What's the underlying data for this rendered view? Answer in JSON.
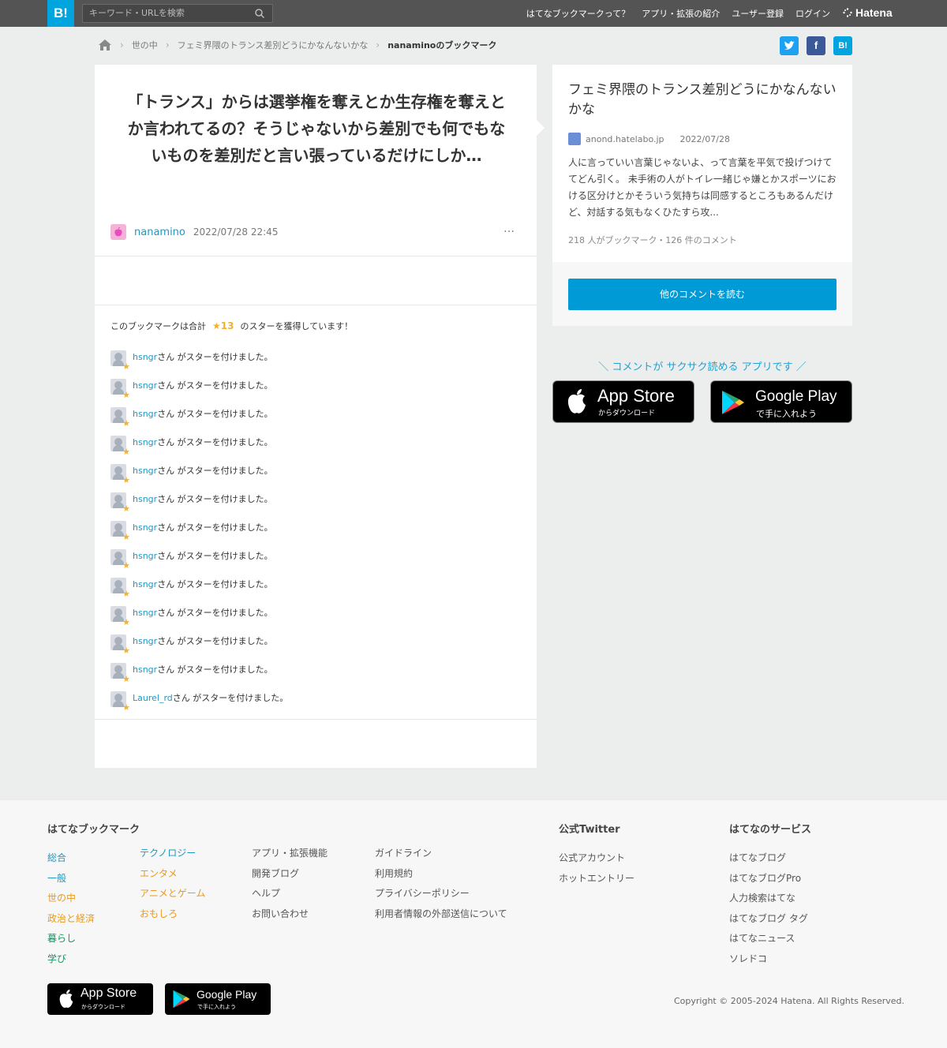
{
  "header": {
    "logo": "B!",
    "search_placeholder": "キーワード・URLを検索",
    "nav": [
      "はてなブックマークって？",
      "アプリ・拡張の紹介",
      "ユーザー登録",
      "ログイン"
    ],
    "brand": "Hatena"
  },
  "breadcrumb": {
    "items": [
      "世の中",
      "フェミ界隈のトランス差別どうにかなんないかな"
    ],
    "current": "nanaminoのブックマーク"
  },
  "share": {
    "twitter": "t",
    "facebook": "f",
    "hatena": "B!"
  },
  "bookmark": {
    "comment": "「トランス」からは選挙権を奪えとか生存権を奪えとか言われてるの？そうじゃないから差別でも何でもないものを差別だと言い張っているだけにしか…",
    "user": "nanamino",
    "datetime": "2022/07/28 22:45",
    "more": "…",
    "stars_prefix": "このブックマークは合計",
    "stars_count": "★13",
    "stars_suffix": "のスターを獲得しています！",
    "stars": [
      {
        "name": "hsngr",
        "text": "さん がスターを付けました。"
      },
      {
        "name": "hsngr",
        "text": "さん がスターを付けました。"
      },
      {
        "name": "hsngr",
        "text": "さん がスターを付けました。"
      },
      {
        "name": "hsngr",
        "text": "さん がスターを付けました。"
      },
      {
        "name": "hsngr",
        "text": "さん がスターを付けました。"
      },
      {
        "name": "hsngr",
        "text": "さん がスターを付けました。"
      },
      {
        "name": "hsngr",
        "text": "さん がスターを付けました。"
      },
      {
        "name": "hsngr",
        "text": "さん がスターを付けました。"
      },
      {
        "name": "hsngr",
        "text": "さん がスターを付けました。"
      },
      {
        "name": "hsngr",
        "text": "さん がスターを付けました。"
      },
      {
        "name": "hsngr",
        "text": "さん がスターを付けました。"
      },
      {
        "name": "hsngr",
        "text": "さん がスターを付けました。"
      },
      {
        "name": "Laurel_rd",
        "text": "さん がスターを付けました。"
      }
    ]
  },
  "entry": {
    "title": "フェミ界隈のトランス差別どうにかなんないかな",
    "source": "anond.hatelabo.jp",
    "date": "2022/07/28",
    "description": "人に言っていい言葉じゃないよ、って言葉を平気で投げつけててどん引く。 未手術の人がトイレ一緒じゃ嫌とかスポーツにおける区分けとかそういう気持ちは同感するところもあるんだけど、対話する気もなくひたすら攻...",
    "counts": "218 人がブックマーク・126 件のコメント",
    "read_button": "他のコメントを読む"
  },
  "app_promo": {
    "tagline": "＼ コメントが サクサク読める アプリです ／",
    "appstore_title": "App Store",
    "appstore_sub": "からダウンロード",
    "googleplay_title": "Google Play",
    "googleplay_sub": "で手に入れよう"
  },
  "footer": {
    "col1_title": "はてなブックマーク",
    "cat_a": [
      "総合",
      "一般",
      "世の中",
      "政治と経済",
      "暮らし",
      "学び"
    ],
    "cat_b": [
      "テクノロジー",
      "エンタメ",
      "アニメとゲーム",
      "おもしろ"
    ],
    "links_c": [
      "アプリ・拡張機能",
      "開発ブログ",
      "ヘルプ",
      "お問い合わせ"
    ],
    "links_d": [
      "ガイドライン",
      "利用規約",
      "プライバシーポリシー",
      "利用者情報の外部送信について"
    ],
    "twitter_title": "公式Twitter",
    "twitter_links": [
      "公式アカウント",
      "ホットエントリー"
    ],
    "services_title": "はてなのサービス",
    "services": [
      "はてなブログ",
      "はてなブログPro",
      "人力検索はてな",
      "はてなブログ タグ",
      "はてなニュース",
      "ソレドコ"
    ],
    "copyright": "Copyright © 2005-2024 Hatena. All Rights Reserved."
  }
}
